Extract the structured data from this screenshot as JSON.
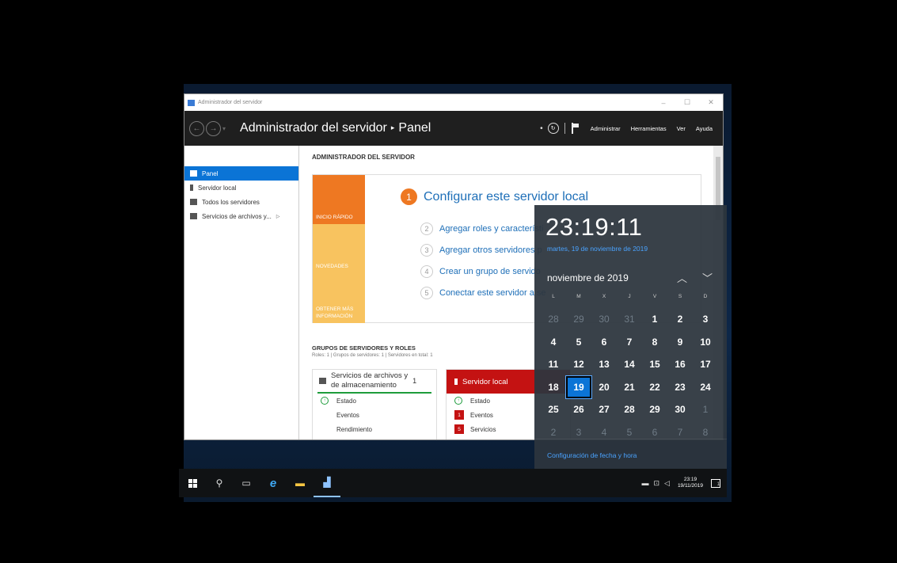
{
  "window": {
    "title": "Administrador del servidor",
    "minimize": "–",
    "maximize": "☐",
    "close": "✕"
  },
  "nav": {
    "breadcrumb_root": "Administrador del servidor",
    "breadcrumb_sep": "▸",
    "breadcrumb_page": "Panel",
    "menus": [
      "Administrar",
      "Herramientas",
      "Ver",
      "Ayuda"
    ]
  },
  "sidebar": {
    "items": [
      {
        "label": "Panel",
        "icon": "dashboard-icon"
      },
      {
        "label": "Servidor local",
        "icon": "server-icon"
      },
      {
        "label": "Todos los servidores",
        "icon": "servers-icon"
      },
      {
        "label": "Servicios de archivos y...",
        "icon": "file-services-icon"
      }
    ],
    "expand_arrow": "▷"
  },
  "main": {
    "section_title": "ADMINISTRADOR DEL SERVIDOR",
    "quick_tabs": [
      "INICIO RÁPIDO",
      "NOVEDADES",
      "OBTENER MÁS INFORMACIÓN"
    ],
    "configure": {
      "num": "1",
      "label": "Configurar este servidor local"
    },
    "steps": [
      {
        "num": "2",
        "label": "Agregar roles y característi"
      },
      {
        "num": "3",
        "label": "Agregar otros servidores p"
      },
      {
        "num": "4",
        "label": "Crear un grupo de servido"
      },
      {
        "num": "5",
        "label": "Conectar este servidor a se"
      }
    ],
    "groups_title": "GRUPOS DE SERVIDORES Y ROLES",
    "groups_subtitle": "Roles: 1  |  Grupos de servidores: 1  |  Servidores en total: 1",
    "card1": {
      "title_line1": "Servicios de archivos y",
      "title_line2": "de almacenamiento",
      "count": "1",
      "rows": [
        "Estado",
        "Eventos",
        "Rendimiento"
      ]
    },
    "card2": {
      "title": "Servidor local",
      "rows": [
        {
          "label": "Estado",
          "badge": ""
        },
        {
          "label": "Eventos",
          "badge": "1"
        },
        {
          "label": "Servicios",
          "badge": "5"
        }
      ]
    }
  },
  "flyout": {
    "time": "23:19:11",
    "long_date": "martes, 19 de noviembre de 2019",
    "month": "noviembre de 2019",
    "weekdays": [
      "L",
      "M",
      "X",
      "J",
      "V",
      "S",
      "D"
    ],
    "weeks": [
      [
        "28",
        "29",
        "30",
        "31",
        "1",
        "2",
        "3"
      ],
      [
        "4",
        "5",
        "6",
        "7",
        "8",
        "9",
        "10"
      ],
      [
        "11",
        "12",
        "13",
        "14",
        "15",
        "16",
        "17"
      ],
      [
        "18",
        "19",
        "20",
        "21",
        "22",
        "23",
        "24"
      ],
      [
        "25",
        "26",
        "27",
        "28",
        "29",
        "30",
        "1"
      ],
      [
        "2",
        "3",
        "4",
        "5",
        "6",
        "7",
        "8"
      ]
    ],
    "today": "19",
    "settings_link": "Configuración de fecha y hora"
  },
  "taskbar": {
    "time": "23:19",
    "date": "19/11/2019",
    "notification_count": "1"
  },
  "colors": {
    "accent": "#0b74d6",
    "orange": "#ee7822",
    "yellow": "#f8c35f",
    "link": "#1e6fb8",
    "alert_red": "#c41212"
  }
}
